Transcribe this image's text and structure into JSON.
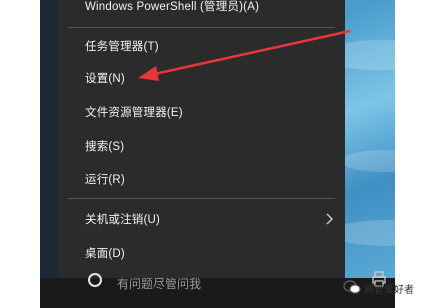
{
  "context_menu": {
    "items": [
      {
        "label": "Windows PowerShell (管理员)(A)"
      },
      {
        "label": "任务管理器(T)"
      },
      {
        "label": "设置(N)"
      },
      {
        "label": "文件资源管理器(E)"
      },
      {
        "label": "搜索(S)"
      },
      {
        "label": "运行(R)"
      },
      {
        "label": "关机或注销(U)",
        "has_submenu": true
      },
      {
        "label": "桌面(D)"
      }
    ]
  },
  "taskbar": {
    "search_text": "有问题尽管问我",
    "cortana_icon": "cortana-ring-icon",
    "tray_icon": "printer-icon"
  },
  "watermark": {
    "text": "网管爱好者",
    "logo_icon": "wechat-logo-icon"
  },
  "colors": {
    "menu_bg": "#2b2b2b",
    "menu_text": "#f2f2f2",
    "annotation_arrow": "#e8363b"
  }
}
